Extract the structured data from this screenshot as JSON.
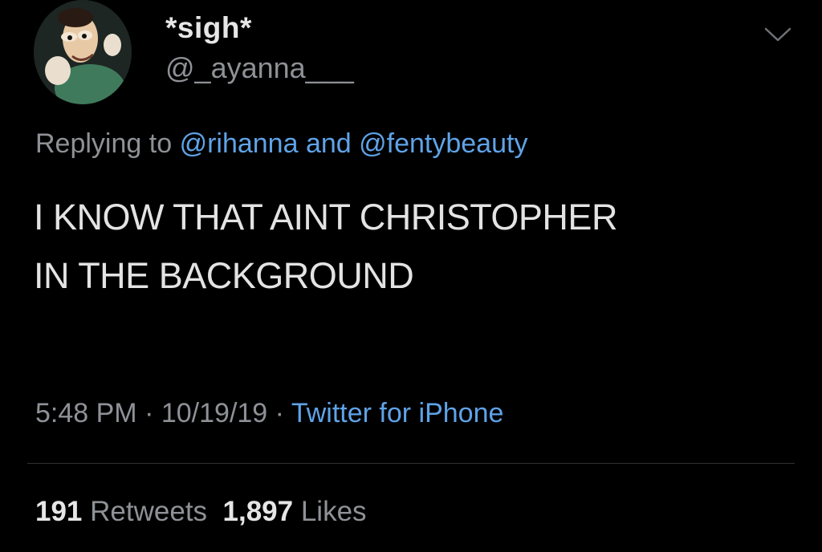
{
  "tweet": {
    "author": {
      "display_name": "*sigh*",
      "handle": "@_ayanna___",
      "avatar_icon": "cartoon-avatar"
    },
    "menu_icon": "chevron-down-icon",
    "reply": {
      "prefix": "Replying to",
      "mention_1": "@rihanna",
      "conjunction": "and",
      "mention_2": "@fentybeauty"
    },
    "text_lines": [
      "I KNOW THAT AINT CHRISTOPHER",
      "IN THE BACKGROUND"
    ],
    "meta": {
      "time": "5:48 PM",
      "separator": "·",
      "date": "10/19/19",
      "source": "Twitter for iPhone"
    },
    "stats": {
      "retweets_count": "191",
      "retweets_label": "Retweets",
      "likes_count": "1,897",
      "likes_label": "Likes"
    }
  },
  "colors": {
    "background": "#000000",
    "link": "#5fa3e8",
    "secondary_text": "#8e9196",
    "primary_text": "#e3e3e3"
  }
}
